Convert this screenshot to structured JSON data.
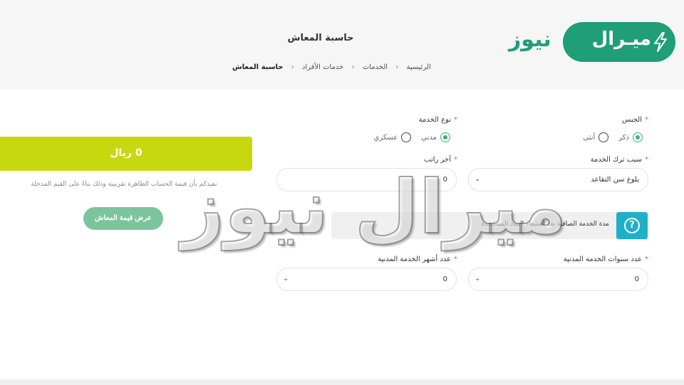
{
  "header": {
    "title": "حاسبة المعاش",
    "breadcrumb": {
      "home": "الرئيسية",
      "services": "الخدمات",
      "individual": "خدمات الأفراد",
      "current": "حاسبة المعاش",
      "separator": "‹"
    }
  },
  "logo": {
    "pill_text": "ميـرال",
    "word": "نيوز",
    "icon": "lightning-bolt-icon",
    "color": "#1f9e77"
  },
  "form": {
    "gender": {
      "label": "الجنس",
      "required": "*",
      "options": {
        "male": "ذكر",
        "female": "أنثى"
      },
      "selected": "ذكر"
    },
    "service_type": {
      "label": "نوع الخدمة",
      "required": "*",
      "options": {
        "civil": "مدني",
        "military": "عسكري"
      },
      "selected": "مدني"
    },
    "termination_reason": {
      "label": "سبب ترك الخدمة",
      "required": "*",
      "value": "بلوغ سن التقاعد"
    },
    "last_salary": {
      "label": "آخر راتب",
      "required": "*",
      "value": "0"
    },
    "info_text": "مدة الخدمة الصافية بعد استبعاد المدد المستبعدة",
    "info_icon": "?",
    "civil_years": {
      "label": "عدد سنوات الخدمة المدنية",
      "required": "*",
      "value": "0"
    },
    "civil_months": {
      "label": "عدد أشهر الخدمة المدنية",
      "required": "*",
      "value": "0"
    },
    "chevron": "⌄"
  },
  "result": {
    "amount": "0 ريال",
    "notice": "نفيدكم بأن قيمة الحساب الظاهرة تقريبية وذلك بناءً على القيم المدخلة",
    "button": "عرض قيمة المعاش",
    "bar_color": "#c8d80e",
    "button_color": "#7cc49c"
  },
  "watermark": "ميرال نيوز"
}
